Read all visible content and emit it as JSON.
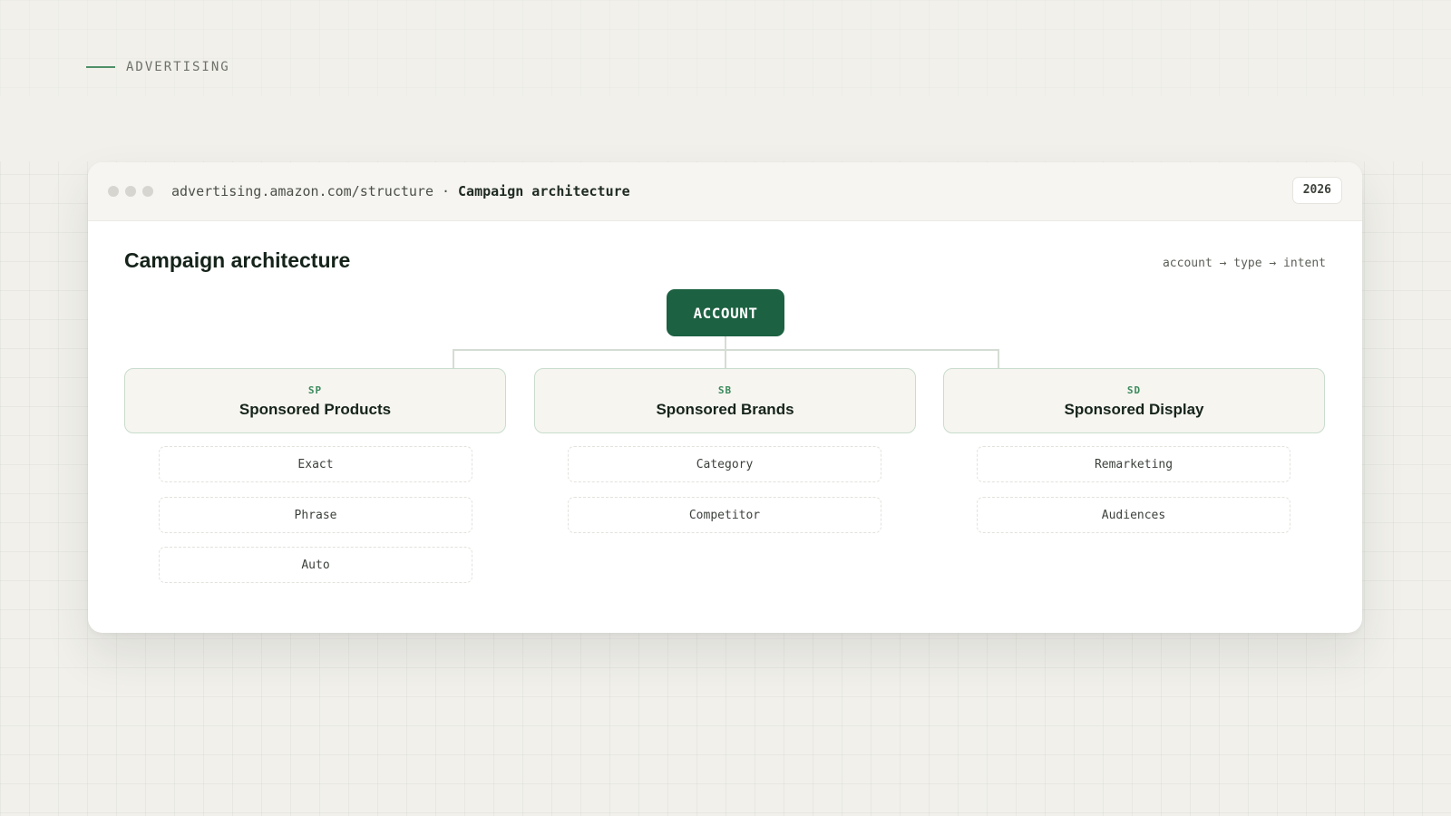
{
  "section_label": "ADVERTISING",
  "window": {
    "url": "advertising.amazon.com/structure",
    "separator": "·",
    "crumb": "Campaign architecture",
    "year": "2026"
  },
  "page": {
    "title": "Campaign architecture",
    "flow_note": "account → type → intent"
  },
  "tree": {
    "root": "ACCOUNT",
    "types": [
      {
        "code": "SP",
        "name": "Sponsored Products",
        "intents": [
          "Exact",
          "Phrase",
          "Auto"
        ]
      },
      {
        "code": "SB",
        "name": "Sponsored Brands",
        "intents": [
          "Category",
          "Competitor"
        ]
      },
      {
        "code": "SD",
        "name": "Sponsored Display",
        "intents": [
          "Remarketing",
          "Audiences"
        ]
      }
    ]
  },
  "colors": {
    "accent": "#1c6141",
    "code_green": "#3a8a5c",
    "background": "#f1f0eb"
  }
}
